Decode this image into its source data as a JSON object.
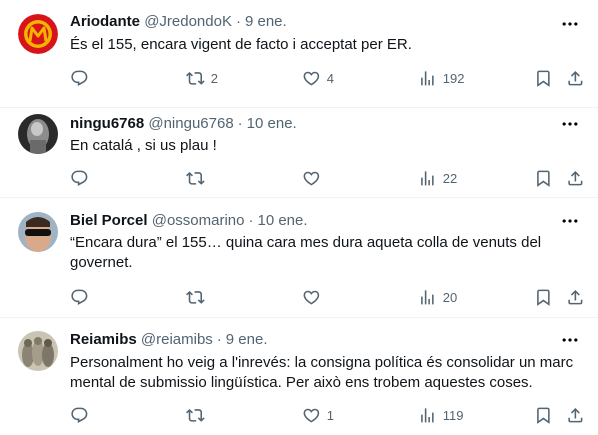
{
  "colors": {
    "text": "#0f1419",
    "muted": "#536471",
    "divider": "#eff3f4"
  },
  "icons": {
    "reply": "reply-icon",
    "retweet": "retweet-icon",
    "like": "like-icon",
    "views": "views-icon",
    "bookmark": "bookmark-icon",
    "share": "share-icon",
    "more": "more-icon"
  },
  "tweets": [
    {
      "name": "Ariodante",
      "handle": "@JredondoK",
      "separator": "·",
      "time": "9 ene.",
      "text": "És el 155, encara vigent de facto i acceptat per ER.",
      "replies": "",
      "retweets": "2",
      "likes": "4",
      "views": "192"
    },
    {
      "name": "ningu6768",
      "handle": "@ningu6768",
      "separator": "·",
      "time": "10 ene.",
      "text": "En catalá , si us plau  !",
      "replies": "",
      "retweets": "",
      "likes": "",
      "views": "22"
    },
    {
      "name": "Biel Porcel",
      "handle": "@ossomarino",
      "separator": "·",
      "time": "10 ene.",
      "text": "“Encara dura” el 155… quina cara mes dura aqueta colla de venuts del governet.",
      "replies": "",
      "retweets": "",
      "likes": "",
      "views": "20"
    },
    {
      "name": "Reiamibs",
      "handle": "@reiamibs",
      "separator": "·",
      "time": "9 ene.",
      "text": "Personalment ho veig a l'inrevés: la consigna política és consolidar un marc mental de submissio lingüística. Per això ens trobem aquestes coses.",
      "replies": "",
      "retweets": "",
      "likes": "1",
      "views": "119"
    }
  ]
}
